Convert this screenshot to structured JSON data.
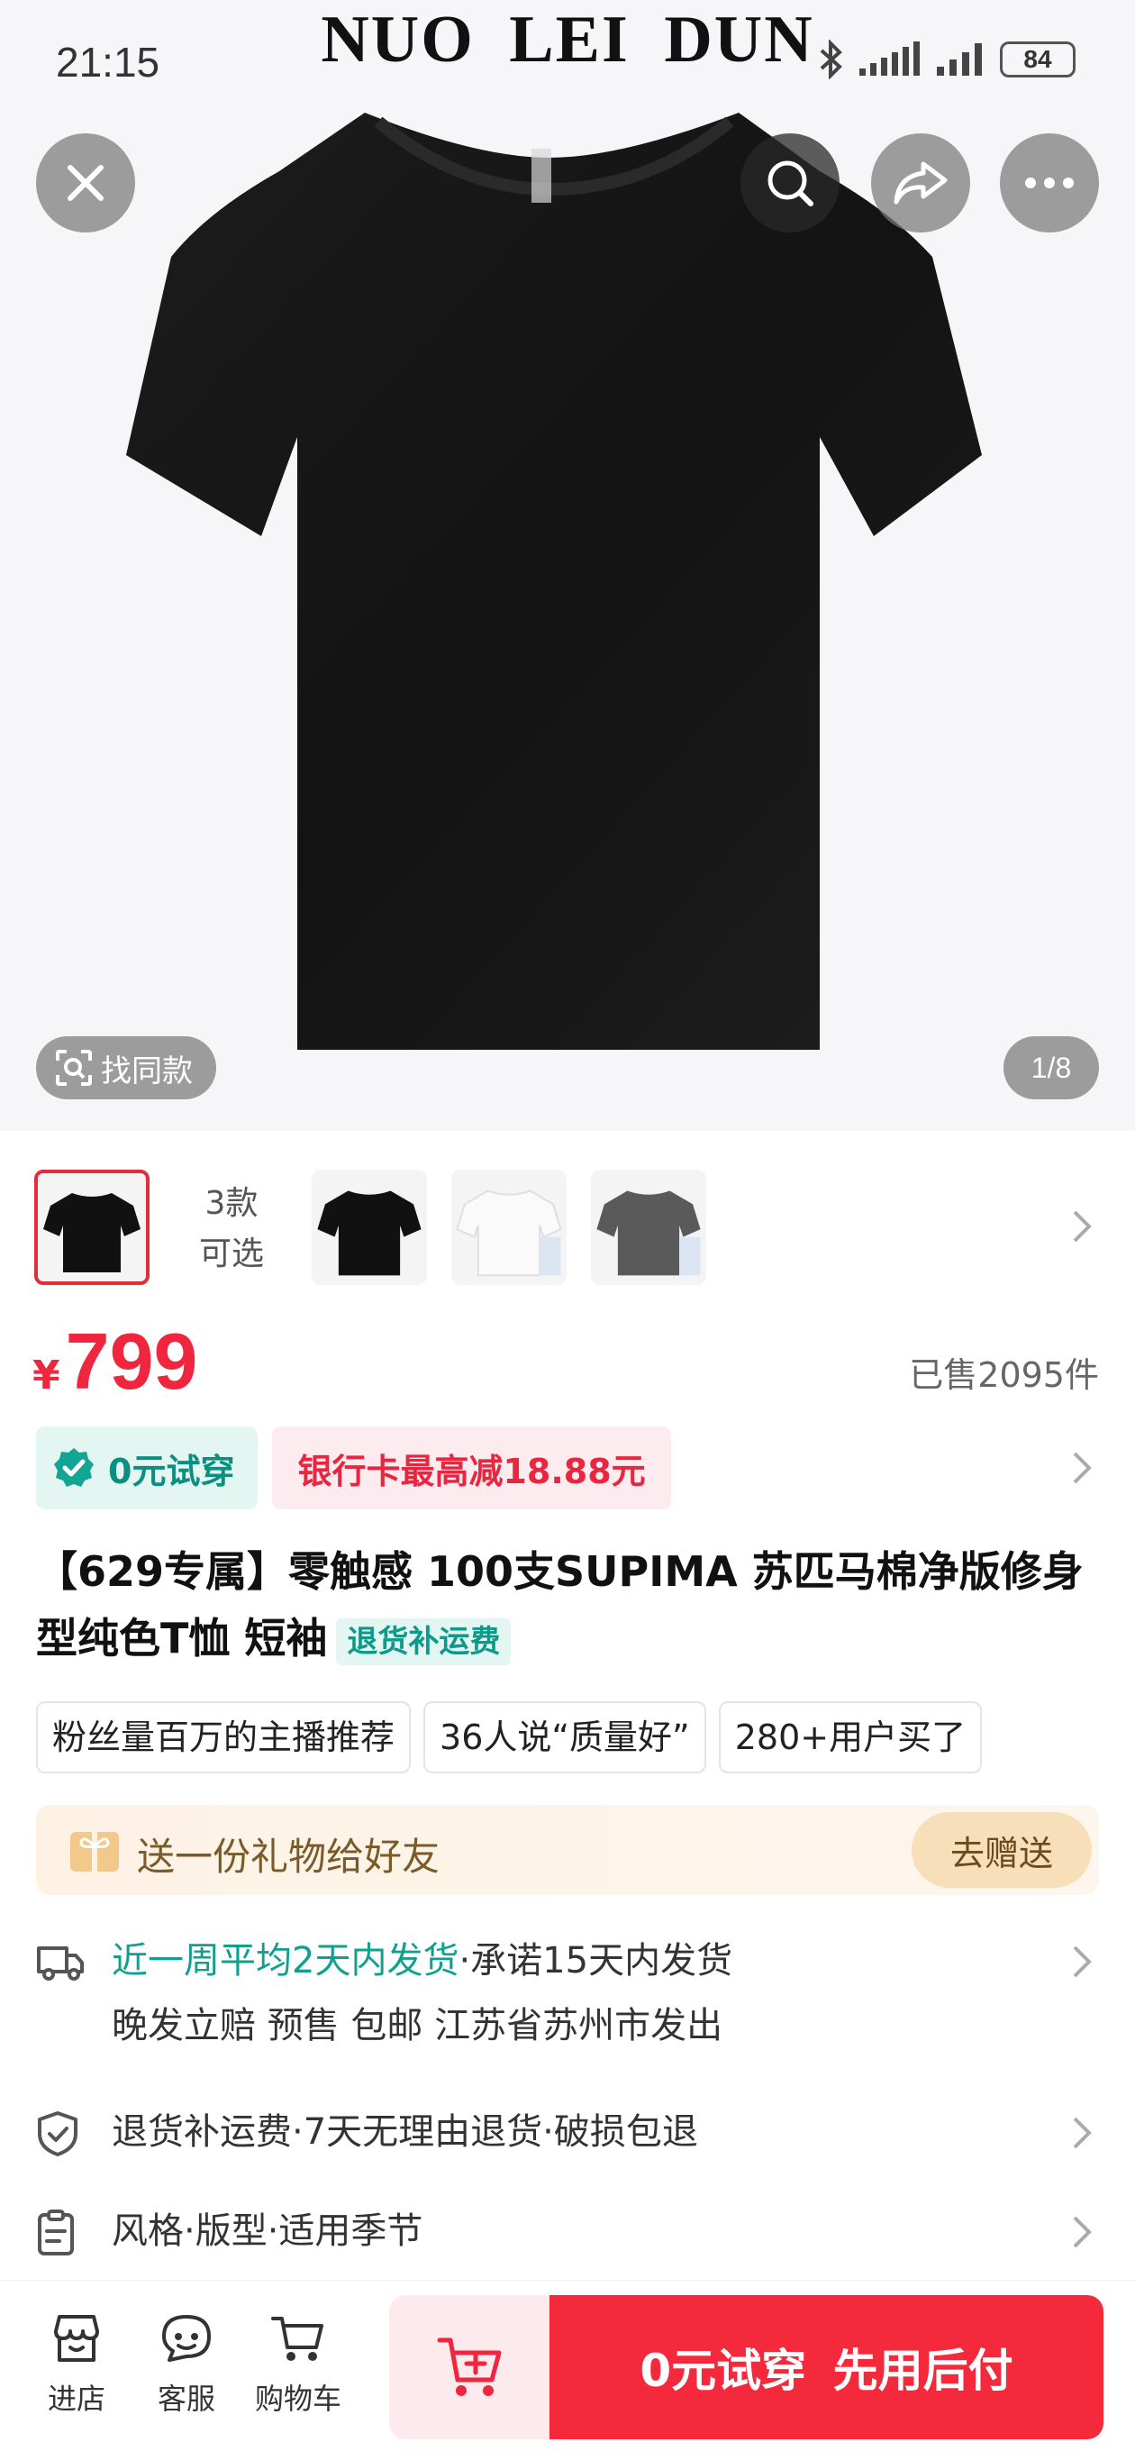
{
  "status_bar": {
    "time": "21:15",
    "battery": "84",
    "icons": [
      "bluetooth-icon",
      "signal-icon",
      "signal-icon",
      "battery-icon"
    ]
  },
  "hero": {
    "brand_overlay": "NUO  LEI  DUN",
    "find_same_label": "找同款",
    "pager": "1/8",
    "icons": [
      "close-icon",
      "search-icon",
      "share-icon",
      "more-icon",
      "scan-icon"
    ]
  },
  "variants": {
    "text_line1": "3款",
    "text_line2": "可选",
    "thumb_colors": [
      "black",
      "black",
      "white",
      "gray"
    ]
  },
  "price": {
    "currency": "¥",
    "value": "799",
    "sold": "已售2095件"
  },
  "promo": {
    "trial_label": "0元试穿",
    "bank_offer": "银行卡最高减18.88元"
  },
  "title": {
    "text": "【629专属】零触感 100支SUPIMA 苏匹马棉净版修身型纯色T恤 短袖",
    "badge": "退货补运费"
  },
  "social_tags": [
    "粉丝量百万的主播推荐",
    "36人说“质量好”",
    "280+用户买了"
  ],
  "gift": {
    "text": "送一份礼物给好友",
    "button": "去赠送"
  },
  "info": {
    "shipping_highlight": "近一周平均2天内发货",
    "shipping_rest": "·承诺15天内发货",
    "shipping_line2": "晚发立赔  预售  包邮  江苏省苏州市发出",
    "guarantee": "退货补运费·7天无理由退货·破损包退",
    "params": "风格·版型·适用季节"
  },
  "bottom_bar": {
    "store": "进店",
    "service": "客服",
    "cart": "购物车",
    "cta": "0元试穿 先用后付"
  },
  "colors": {
    "accent_red": "#f42a3c",
    "price_red": "#f0263f",
    "teal": "#11a08f",
    "gift_bg": "#fdf2e4"
  }
}
